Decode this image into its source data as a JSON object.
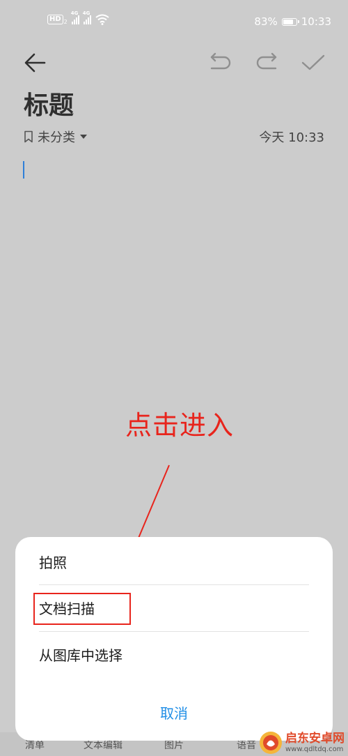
{
  "status_bar": {
    "hd": "HD",
    "sim": "2",
    "network_1": "4G",
    "network_2": "4G",
    "battery": "83%",
    "battery_level": 0.83,
    "time": "10:33"
  },
  "toolbar": {
    "back_icon": "arrow-left-icon",
    "undo_icon": "undo-icon",
    "redo_icon": "redo-icon",
    "confirm_icon": "checkmark-icon"
  },
  "note": {
    "title": "标题",
    "category": "未分类",
    "date": "今天 10:33"
  },
  "annotation": {
    "text": "点击进入",
    "color": "#e8241c"
  },
  "sheet": {
    "items": [
      {
        "label": "拍照"
      },
      {
        "label": "文档扫描"
      },
      {
        "label": "从图库中选择"
      }
    ],
    "cancel": "取消"
  },
  "bottom_toolbar": {
    "items": [
      "清单",
      "文本编辑",
      "图片",
      "语音"
    ]
  },
  "watermark": {
    "name": "启东安卓网",
    "url": "www.qdltdq.com"
  },
  "colors": {
    "background": "#cccccc",
    "accent": "#1f8ee6",
    "cursor": "#2f7fd8"
  }
}
